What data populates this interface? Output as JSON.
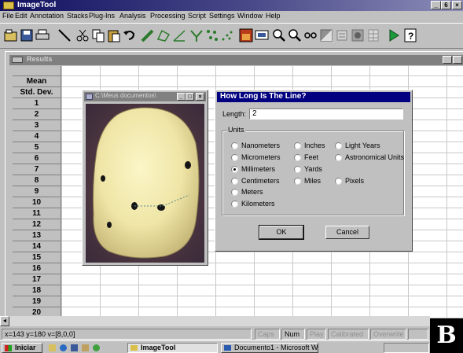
{
  "app": {
    "title": "ImageTool",
    "title_controls": [
      "_",
      "6",
      "×"
    ]
  },
  "menu": [
    "File",
    "Edit",
    "Annotation",
    "Stacks",
    "Plug-Ins",
    "Analysis",
    "Processing",
    "Script",
    "Settings",
    "Window",
    "Help"
  ],
  "results_window": {
    "title": "Results",
    "header_rows": [
      "Mean",
      "Std. Dev."
    ],
    "row_numbers": [
      "1",
      "2",
      "3",
      "4",
      "5",
      "6",
      "7",
      "8",
      "9",
      "10",
      "11",
      "12",
      "13",
      "14",
      "15",
      "16",
      "17",
      "18",
      "19",
      "20"
    ]
  },
  "image_window": {
    "title": "C:\\Meus documentos\\"
  },
  "dialog": {
    "title": "How Long Is The Line?",
    "length_label": "Length:",
    "length_value": "2",
    "units_label": "Units",
    "units": [
      {
        "label": "Nanometers",
        "selected": false
      },
      {
        "label": "Micrometers",
        "selected": false
      },
      {
        "label": "Millimeters",
        "selected": true
      },
      {
        "label": "Centimeters",
        "selected": false
      },
      {
        "label": "Meters",
        "selected": false
      },
      {
        "label": "Kilometers",
        "selected": false
      },
      {
        "label": "Inches",
        "selected": false
      },
      {
        "label": "Feet",
        "selected": false
      },
      {
        "label": "Yards",
        "selected": false
      },
      {
        "label": "Miles",
        "selected": false
      },
      {
        "label": "Light Years",
        "selected": false
      },
      {
        "label": "Astronomical Units",
        "selected": false
      },
      {
        "label": "Pixels",
        "selected": false
      }
    ],
    "ok_label": "OK",
    "cancel_label": "Cancel"
  },
  "status_bar": {
    "coords": "x=143 y=180 v=[8,0,0]",
    "indicators": [
      {
        "label": "Caps",
        "active": false
      },
      {
        "label": "Num",
        "active": true
      },
      {
        "label": "Play",
        "active": false
      },
      {
        "label": "Calibrated",
        "active": false
      },
      {
        "label": "Overwrite",
        "active": false
      }
    ]
  },
  "taskbar": {
    "start_label": "Iniciar",
    "tasks": [
      "ImageTool",
      "Documento1 - Microsoft W"
    ]
  },
  "panel_label": "B",
  "colors": {
    "dialog_title": "#000080",
    "inactive_title": "#808080",
    "face": "#c0c0c0"
  }
}
